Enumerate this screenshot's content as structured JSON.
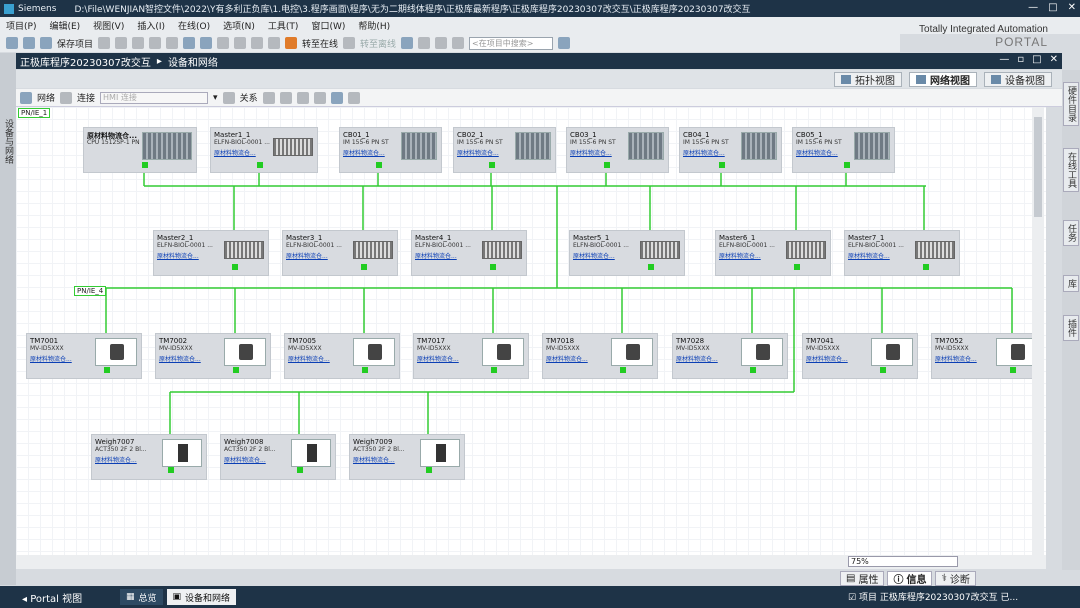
{
  "window": {
    "app": "Siemens",
    "path": "D:\\File\\WENJIAN智控文件\\2022\\Y有多利正负库\\1.电控\\3.程序画面\\程序\\无为二期线体程序\\正极库最新程序\\正极库程序20230307改交互\\正极库程序20230307改交互"
  },
  "menu": [
    "项目(P)",
    "编辑(E)",
    "视图(V)",
    "插入(I)",
    "在线(O)",
    "选项(N)",
    "工具(T)",
    "窗口(W)",
    "帮助(H)"
  ],
  "brand": {
    "line1": "Totally Integrated Automation",
    "line2": "PORTAL"
  },
  "toolbar": {
    "save": "保存项目",
    "go_online": "转至在线",
    "go_offline": "转至离线",
    "search_placeholder": "<在项目中搜索>"
  },
  "editor": {
    "breadcrumb_root": "正极库程序20230307改交互",
    "breadcrumb_leaf": "设备和网络"
  },
  "left_strip": "设备与网络",
  "view_tabs": {
    "topology": "拓扑视图",
    "network": "网络视图",
    "device": "设备视图"
  },
  "canvas_toolbar": {
    "network": "网络",
    "connect": "连接",
    "hmi": "HMI 连接",
    "relations": "关系"
  },
  "right_tabs": [
    "硬件目录",
    "在线工具",
    "任务",
    "库",
    "插件"
  ],
  "subnets": [
    "PN/IE_1",
    "PN/IE_4"
  ],
  "devices": {
    "plc": {
      "name": "原材料物流仓...",
      "type": "CPU 1512SP-1 PN"
    },
    "master1": {
      "name": "Master1_1",
      "type": "ELFN-BIOL-0001 ...",
      "link": "原材料物流仓..."
    },
    "cb": [
      {
        "name": "CB01_1",
        "type": "IM 155-6 PN ST",
        "link": "原材料物流仓..."
      },
      {
        "name": "CB02_1",
        "type": "IM 155-6 PN ST",
        "link": "原材料物流仓..."
      },
      {
        "name": "CB03_1",
        "type": "IM 155-6 PN ST",
        "link": "原材料物流仓..."
      },
      {
        "name": "CB04_1",
        "type": "IM 155-6 PN ST",
        "link": "原材料物流仓..."
      },
      {
        "name": "CB05_1",
        "type": "IM 155-6 PN ST",
        "link": "原材料物流仓..."
      }
    ],
    "masters": [
      {
        "name": "Master2_1",
        "type": "ELFN-BIOL-0001 ...",
        "link": "原材料物流仓..."
      },
      {
        "name": "Master3_1",
        "type": "ELFN-BIOL-0001 ...",
        "link": "原材料物流仓..."
      },
      {
        "name": "Master4_1",
        "type": "ELFN-BIOL-0001 ...",
        "link": "原材料物流仓..."
      },
      {
        "name": "Master5_1",
        "type": "ELFN-BIOL-0001 ...",
        "link": "原材料物流仓..."
      },
      {
        "name": "Master6_1",
        "type": "ELFN-BIOL-0001 ...",
        "link": "原材料物流仓..."
      },
      {
        "name": "Master7_1",
        "type": "ELFN-BIOL-0001 ...",
        "link": "原材料物流仓..."
      }
    ],
    "tm": [
      {
        "name": "TM7001",
        "type": "MV-ID5XXX",
        "link": "原材料物流仓..."
      },
      {
        "name": "TM7002",
        "type": "MV-ID5XXX",
        "link": "原材料物流仓..."
      },
      {
        "name": "TM7005",
        "type": "MV-ID5XXX",
        "link": "原材料物流仓..."
      },
      {
        "name": "TM7017",
        "type": "MV-ID5XXX",
        "link": "原材料物流仓..."
      },
      {
        "name": "TM7018",
        "type": "MV-ID5XXX",
        "link": "原材料物流仓..."
      },
      {
        "name": "TM7028",
        "type": "MV-ID5XXX",
        "link": "原材料物流仓..."
      },
      {
        "name": "TM7041",
        "type": "MV-ID5XXX",
        "link": "原材料物流仓..."
      },
      {
        "name": "TM7052",
        "type": "MV-ID5XXX",
        "link": "原材料物流仓..."
      }
    ],
    "weigh": [
      {
        "name": "Weigh7007",
        "type": "ACT350 2F 2 Bl...",
        "link": "原材料物流仓..."
      },
      {
        "name": "Weigh7008",
        "type": "ACT350 2F 2 Bl...",
        "link": "原材料物流仓..."
      },
      {
        "name": "Weigh7009",
        "type": "ACT350 2F 2 Bl...",
        "link": "原材料物流仓..."
      }
    ]
  },
  "zoom": "75%",
  "inspector": {
    "properties": "属性",
    "info": "信息",
    "diagnostics": "诊断"
  },
  "taskbar": {
    "portal": "Portal 视图",
    "overview": "总览",
    "devices": "设备和网络"
  },
  "status": "项目 正极库程序20230307改交互 已...",
  "colors": {
    "title_bg": "#1e3347",
    "wire": "#33cc33",
    "link": "#0b3fb5"
  }
}
